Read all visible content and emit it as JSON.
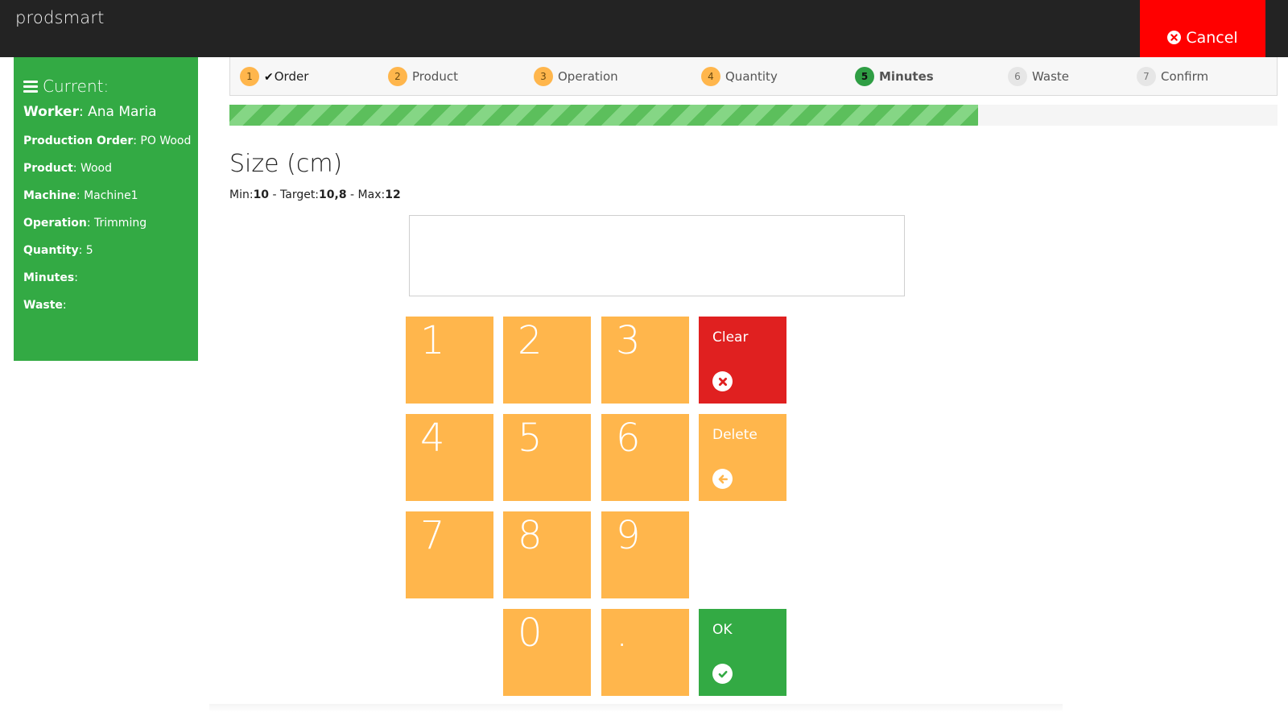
{
  "app": {
    "logo": "prodsmart"
  },
  "header": {
    "cancel_label": "Cancel"
  },
  "sidebar": {
    "title": "Current:",
    "worker_label": "Worker",
    "worker_value": "Ana Maria",
    "items": [
      {
        "label": "Production Order",
        "value": "PO Wood"
      },
      {
        "label": "Product",
        "value": "Wood"
      },
      {
        "label": "Machine",
        "value": "Machine1"
      },
      {
        "label": "Operation",
        "value": "Trimming"
      },
      {
        "label": "Quantity",
        "value": "5"
      },
      {
        "label": "Minutes",
        "value": ""
      },
      {
        "label": "Waste",
        "value": ""
      }
    ]
  },
  "steps": [
    {
      "num": "1",
      "label": "Order",
      "state": "done"
    },
    {
      "num": "2",
      "label": "Product",
      "state": "pending"
    },
    {
      "num": "3",
      "label": "Operation",
      "state": "pending"
    },
    {
      "num": "4",
      "label": "Quantity",
      "state": "pending"
    },
    {
      "num": "5",
      "label": "Minutes",
      "state": "active"
    },
    {
      "num": "6",
      "label": "Waste",
      "state": "todo"
    },
    {
      "num": "7",
      "label": "Confirm",
      "state": "todo"
    }
  ],
  "progress": {
    "fraction": 0.714
  },
  "field": {
    "title": "Size (cm)",
    "min_label": "Min:",
    "min": "10",
    "target_label": " - Target:",
    "target": "10,8",
    "max_label": " - Max:",
    "max": "12",
    "value": ""
  },
  "keypad": {
    "digits": [
      "1",
      "2",
      "3",
      "4",
      "5",
      "6",
      "7",
      "8",
      "9",
      "0",
      "."
    ],
    "clear_label": "Clear",
    "delete_label": "Delete",
    "ok_label": "OK"
  },
  "colors": {
    "topbar": "#232323",
    "cancel": "#ff0000",
    "sidebar": "#33aa44",
    "key": "#ffb64c",
    "clear": "#e02020",
    "ok": "#33aa44",
    "progress": "#5cbf5c"
  }
}
